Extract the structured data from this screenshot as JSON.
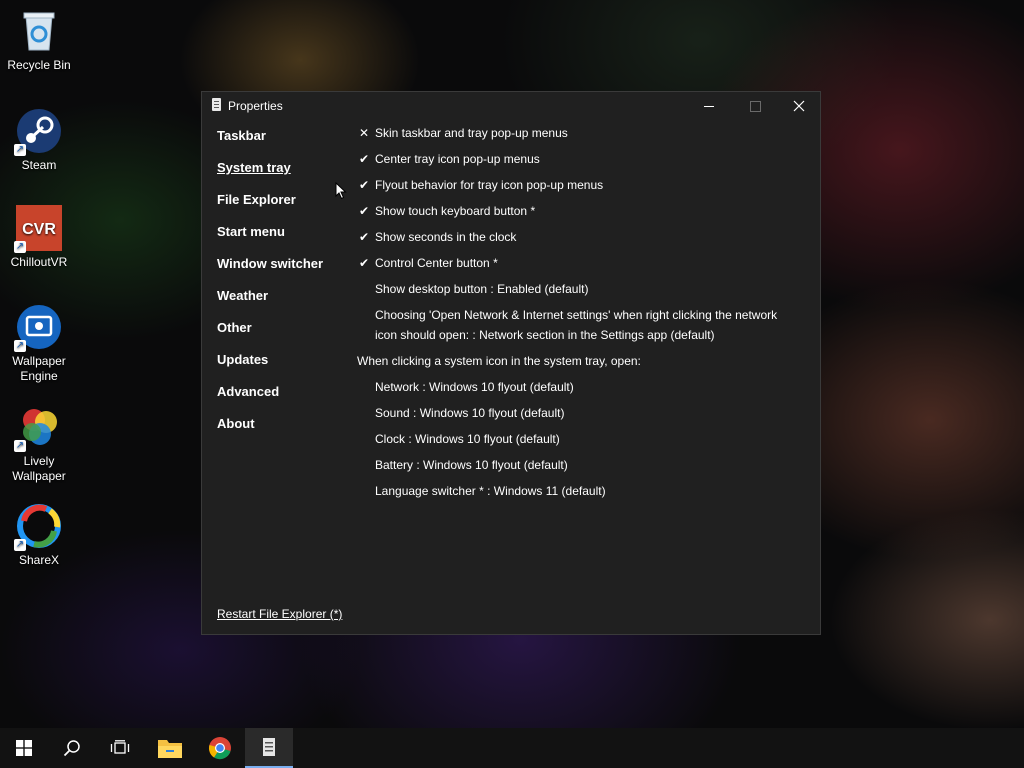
{
  "desktop": {
    "icons": [
      {
        "label": "Recycle Bin"
      },
      {
        "label": "Steam"
      },
      {
        "label": "ChilloutVR"
      },
      {
        "label": "Wallpaper Engine"
      },
      {
        "label": "Lively Wallpaper"
      },
      {
        "label": "ShareX"
      }
    ]
  },
  "window": {
    "title": "Properties",
    "nav": [
      {
        "label": "Taskbar"
      },
      {
        "label": "System tray"
      },
      {
        "label": "File Explorer"
      },
      {
        "label": "Start menu"
      },
      {
        "label": "Window switcher"
      },
      {
        "label": "Weather"
      },
      {
        "label": "Other"
      },
      {
        "label": "Updates"
      },
      {
        "label": "Advanced"
      },
      {
        "label": "About"
      }
    ],
    "options": [
      {
        "mark": "✕",
        "text": "Skin taskbar and tray pop-up menus"
      },
      {
        "mark": "✔",
        "text": "Center tray icon pop-up menus"
      },
      {
        "mark": "✔",
        "text": "Flyout behavior for tray icon pop-up menus"
      },
      {
        "mark": "✔",
        "text": "Show touch keyboard button *"
      },
      {
        "mark": "✔",
        "text": "Show seconds in the clock"
      },
      {
        "mark": "✔",
        "text": "Control Center button *"
      },
      {
        "mark": "",
        "text": "Show desktop button : Enabled (default)"
      },
      {
        "mark": "",
        "text": "Choosing 'Open Network & Internet settings' when right clicking the network icon should open: : Network section in the Settings app (default)"
      }
    ],
    "section_heading": "When clicking a system icon in the system tray, open:",
    "tray_options": [
      {
        "text": "Network : Windows 10 flyout (default)"
      },
      {
        "text": "Sound : Windows 10 flyout (default)"
      },
      {
        "text": "Clock : Windows 10 flyout (default)"
      },
      {
        "text": "Battery : Windows 10 flyout (default)"
      },
      {
        "text": "Language switcher * : Windows 11 (default)"
      }
    ],
    "restart_link": "Restart File Explorer (*)"
  },
  "taskbar": {
    "buttons": [
      "start-icon",
      "search-icon",
      "task-view-icon",
      "file-explorer-icon",
      "chrome-icon",
      "properties-app-icon"
    ]
  }
}
